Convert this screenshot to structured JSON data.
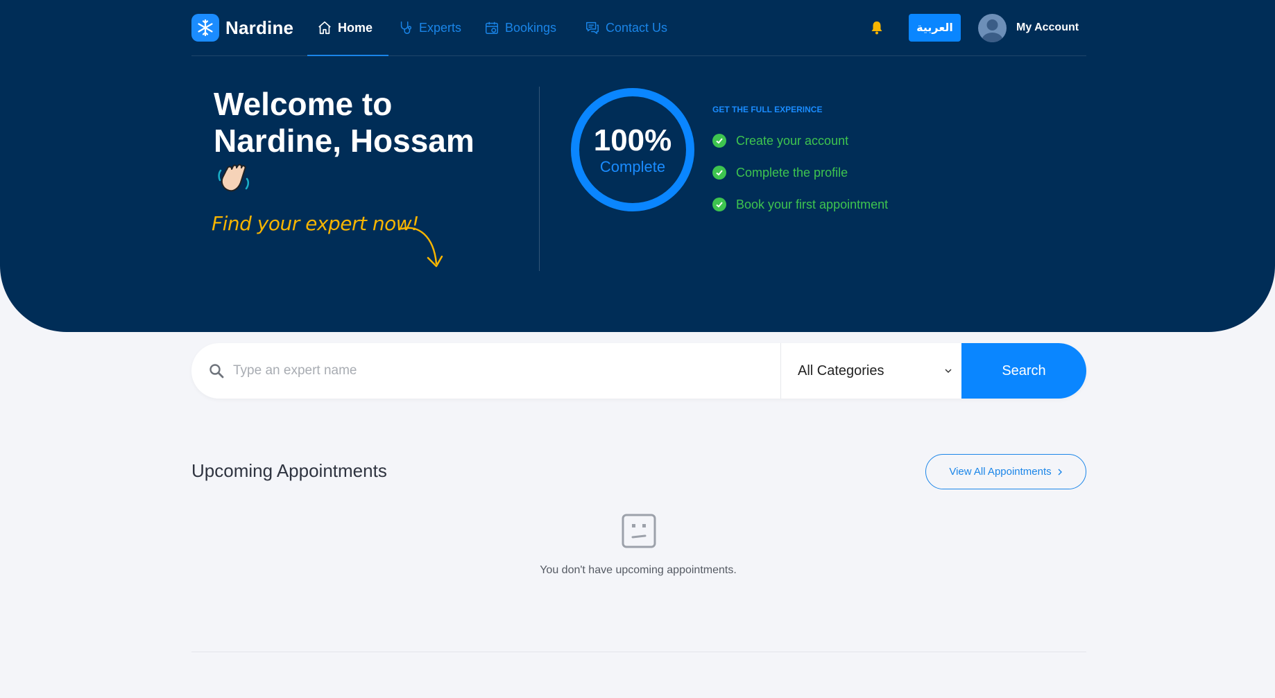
{
  "brand": {
    "name": "Nardine",
    "accent": "#0a86ff",
    "hero_bg": "#002d57",
    "success": "#3ec44f",
    "highlight": "#f7b500"
  },
  "nav": {
    "items": [
      {
        "label": "Home",
        "icon": "home-icon",
        "active": true
      },
      {
        "label": "Experts",
        "icon": "stethoscope-icon"
      },
      {
        "label": "Bookings",
        "icon": "calendar-icon"
      },
      {
        "label": "Contact Us",
        "icon": "chat-icon"
      }
    ],
    "notification_icon": "bell-icon",
    "language_button": "العربية",
    "account_label": "My Account"
  },
  "hero": {
    "welcome_line1": "Welcome to",
    "welcome_line2": "Nardine, Hossam",
    "cta_text": "Find your expert now!",
    "progress": {
      "percent": 100,
      "percent_label": "100%",
      "status": "Complete"
    },
    "experience_title": "GET THE FULL EXPERINCE",
    "steps": [
      {
        "label": "Create your account",
        "done": true
      },
      {
        "label": "Complete the profile",
        "done": true
      },
      {
        "label": "Book your first appointment",
        "done": true
      }
    ]
  },
  "search": {
    "placeholder": "Type an expert name",
    "value": "",
    "category_selected": "All Categories",
    "button_label": "Search"
  },
  "appointments": {
    "title": "Upcoming Appointments",
    "view_all_label": "View All Appointments",
    "empty_message": "You don't have upcoming appointments."
  }
}
